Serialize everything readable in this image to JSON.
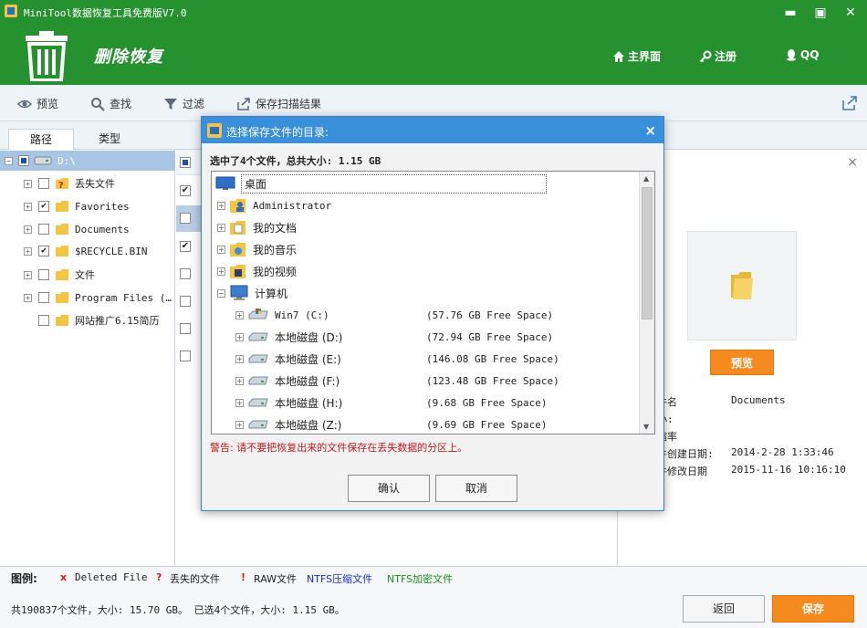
{
  "window": {
    "title": "MiniTool数据恢复工具免费版V7.0",
    "minimize": "▬",
    "maximize": "▣",
    "close": "✕"
  },
  "header": {
    "mode_title": "删除恢复",
    "nav": [
      {
        "label": "主界面",
        "icon": "home-icon"
      },
      {
        "label": "注册",
        "icon": "key-icon"
      },
      {
        "label": "QQ",
        "icon": "qq-icon"
      }
    ]
  },
  "toolbar": {
    "preview": "预览",
    "find": "查找",
    "filter": "过滤",
    "save_scan": "保存扫描结果"
  },
  "tabs": {
    "path": "路径",
    "type": "类型"
  },
  "tree": {
    "root": "D:\\",
    "items": [
      {
        "label": "丢失文件",
        "checked": false
      },
      {
        "label": "Favorites",
        "checked": true
      },
      {
        "label": "Documents",
        "checked": false
      },
      {
        "label": "$RECYCLE.BIN",
        "checked": true
      },
      {
        "label": "文件",
        "checked": false
      },
      {
        "label": "Program Files (…",
        "checked": false
      },
      {
        "label": "网站推广6.15简历",
        "checked": false
      }
    ]
  },
  "preview_panel": {
    "close": "×",
    "preview_button": "预览",
    "props": [
      {
        "key": "件名",
        "value": "Documents"
      },
      {
        "key": "小:",
        "value": ""
      },
      {
        "key": "缩率",
        "value": ""
      },
      {
        "key": "件创建日期:",
        "value": "2014-2-28 1:33:46"
      },
      {
        "key": "件修改日期",
        "value": "2015-11-16 10:16:10"
      }
    ]
  },
  "legend": {
    "title": "图例:",
    "deleted": "Deleted File",
    "lost": "丢失的文件",
    "raw": "RAW文件",
    "ntfs_compressed": "NTFS压缩文件",
    "ntfs_encrypted": "NTFS加密文件",
    "colors": {
      "deleted": "#d71f1f",
      "ntfs_compressed": "#1f2fb5",
      "ntfs_encrypted": "#1f8a1f"
    }
  },
  "status": {
    "summary": "共190837个文件，大小: 15.70 GB。 已选4个文件，大小: 1.15 GB。",
    "back": "返回",
    "save": "保存"
  },
  "dialog": {
    "title": "选择保存文件的目录:",
    "close": "×",
    "summary": "选中了4个文件，总共大小: 1.15 GB",
    "warning": "警告: 请不要把恢复出来的文件保存在丢失数据的分区上。",
    "ok": "确认",
    "cancel": "取消",
    "tree": {
      "desktop": "桌面",
      "user_items": [
        "Administrator",
        "我的文档",
        "我的音乐",
        "我的视频"
      ],
      "computer": "计算机",
      "drives": [
        {
          "label": "Win7 (C:)",
          "free": "(57.76 GB Free Space)"
        },
        {
          "label": "本地磁盘 (D:)",
          "free": "(72.94 GB Free Space)"
        },
        {
          "label": "本地磁盘 (E:)",
          "free": "(146.08 GB Free Space)"
        },
        {
          "label": "本地磁盘 (F:)",
          "free": "(123.48 GB Free Space)"
        },
        {
          "label": "本地磁盘 (H:)",
          "free": "(9.68 GB Free Space)"
        },
        {
          "label": "本地磁盘 (Z:)",
          "free": "(9.69 GB Free Space)"
        }
      ]
    }
  }
}
